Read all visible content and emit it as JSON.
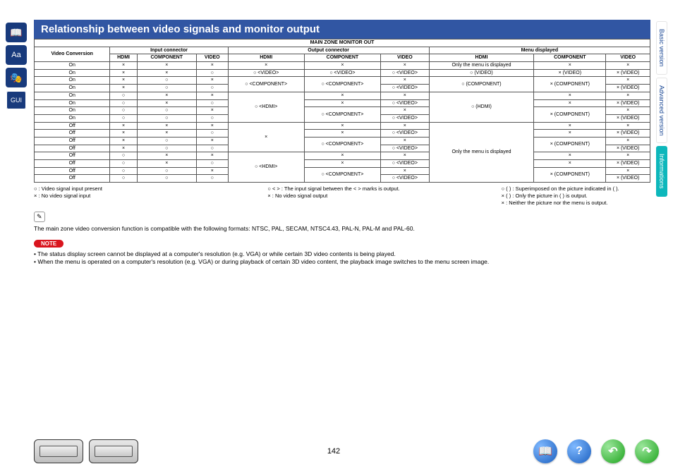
{
  "title": "Relationship between video signals and monitor output",
  "page_number": "142",
  "side_tabs": {
    "basic": "Basic version",
    "advanced": "Advanced version",
    "informations": "Informations"
  },
  "table": {
    "header": {
      "top": "MAIN ZONE MONITOR OUT",
      "vc": "Video Conversion",
      "input": "Input connector",
      "output": "Output connector",
      "menu": "Menu displayed",
      "cols": [
        "HDMI",
        "COMPONENT",
        "VIDEO",
        "HDMI",
        "COMPONENT",
        "VIDEO",
        "HDMI",
        "COMPONENT",
        "VIDEO"
      ]
    },
    "on_label": "On",
    "off_label": "Off",
    "menu_only_text": "Only the menu is displayed",
    "mark": {
      "o": "○",
      "x": "×"
    },
    "cell": {
      "hdmi_out": "○ <HDMI>",
      "comp_out": "○ <COMPONENT>",
      "video_out": "○ <VIDEO>",
      "hdmi_menu": "○ (HDMI)",
      "comp_menu": "× (COMPONENT)",
      "video_menu": "× (VIDEO)",
      "video_menu_o": "○ (VIDEO)",
      "comp_menu_o": "○ (COMPONENT)"
    }
  },
  "legend": {
    "l1": "○ : Video signal input present",
    "l2": "× : No video signal input",
    "m1": "○ < > : The input signal between the < > marks is output.",
    "m2": "×       : No video signal output",
    "r1": "○ ( ) : Superimposed on the picture indicated in ( ).",
    "r2": "× ( ) : Only the picture in ( ) is output.",
    "r3": "×       : Neither the picture nor the menu is output."
  },
  "compat_text": "The main zone video conversion function is compatible with the following formats: NTSC, PAL, SECAM, NTSC4.43, PAL-N, PAL-M and PAL-60.",
  "note_label": "NOTE",
  "notes": {
    "n1": "• The status display screen cannot be displayed at a computer's resolution (e.g. VGA) or while certain 3D video contents is being played.",
    "n2": "• When the menu is operated on a computer's resolution (e.g. VGA) or during playback of certain 3D video content, the playback image switches to the menu screen image."
  },
  "chart_data": {
    "type": "table",
    "description": "Matrix of Video Conversion On/Off vs Input/Output/Menu columns",
    "columns": [
      "VideoConversion",
      "In_HDMI",
      "In_COMPONENT",
      "In_VIDEO",
      "Out_HDMI",
      "Out_COMPONENT",
      "Out_VIDEO",
      "Menu_HDMI",
      "Menu_COMPONENT",
      "Menu_VIDEO"
    ],
    "rows": [
      [
        "On",
        "×",
        "×",
        "×",
        "×",
        "×",
        "×",
        "Only the menu is displayed",
        "×",
        "×"
      ],
      [
        "On",
        "×",
        "×",
        "○",
        "○ <VIDEO>",
        "○ <VIDEO>",
        "○ <VIDEO>",
        "○ (VIDEO)",
        "× (VIDEO)",
        "× (VIDEO)"
      ],
      [
        "On",
        "×",
        "○",
        "×",
        "○ <COMPONENT>",
        "○ <COMPONENT>",
        "×",
        "○ (COMPONENT)",
        "× (COMPONENT)",
        "×"
      ],
      [
        "On",
        "×",
        "○",
        "○",
        "○ <COMPONENT>",
        "○ <COMPONENT>",
        "○ <VIDEO>",
        "○ (COMPONENT)",
        "× (COMPONENT)",
        "× (VIDEO)"
      ],
      [
        "On",
        "○",
        "×",
        "×",
        "○ <HDMI>",
        "×",
        "×",
        "○ (HDMI)",
        "×",
        "×"
      ],
      [
        "On",
        "○",
        "×",
        "○",
        "○ <HDMI>",
        "×",
        "○ <VIDEO>",
        "○ (HDMI)",
        "×",
        "× (VIDEO)"
      ],
      [
        "On",
        "○",
        "○",
        "×",
        "○ <HDMI>",
        "○ <COMPONENT>",
        "×",
        "○ (HDMI)",
        "× (COMPONENT)",
        "×"
      ],
      [
        "On",
        "○",
        "○",
        "○",
        "○ <HDMI>",
        "○ <COMPONENT>",
        "○ <VIDEO>",
        "○ (HDMI)",
        "× (COMPONENT)",
        "× (VIDEO)"
      ],
      [
        "Off",
        "×",
        "×",
        "×",
        "×",
        "×",
        "×",
        "Only the menu is displayed",
        "×",
        "×"
      ],
      [
        "Off",
        "×",
        "×",
        "○",
        "×",
        "×",
        "○ <VIDEO>",
        "Only the menu is displayed",
        "×",
        "× (VIDEO)"
      ],
      [
        "Off",
        "×",
        "○",
        "×",
        "×",
        "○ <COMPONENT>",
        "×",
        "Only the menu is displayed",
        "× (COMPONENT)",
        "×"
      ],
      [
        "Off",
        "×",
        "○",
        "○",
        "×",
        "○ <COMPONENT>",
        "○ <VIDEO>",
        "Only the menu is displayed",
        "× (COMPONENT)",
        "× (VIDEO)"
      ],
      [
        "Off",
        "○",
        "×",
        "×",
        "○ <HDMI>",
        "×",
        "×",
        "Only the menu is displayed",
        "×",
        "×"
      ],
      [
        "Off",
        "○",
        "×",
        "○",
        "○ <HDMI>",
        "×",
        "○ <VIDEO>",
        "Only the menu is displayed",
        "×",
        "× (VIDEO)"
      ],
      [
        "Off",
        "○",
        "○",
        "×",
        "○ <HDMI>",
        "○ <COMPONENT>",
        "×",
        "Only the menu is displayed",
        "× (COMPONENT)",
        "×"
      ],
      [
        "Off",
        "○",
        "○",
        "○",
        "○ <HDMI>",
        "○ <COMPONENT>",
        "○ <VIDEO>",
        "Only the menu is displayed",
        "× (COMPONENT)",
        "× (VIDEO)"
      ]
    ]
  }
}
